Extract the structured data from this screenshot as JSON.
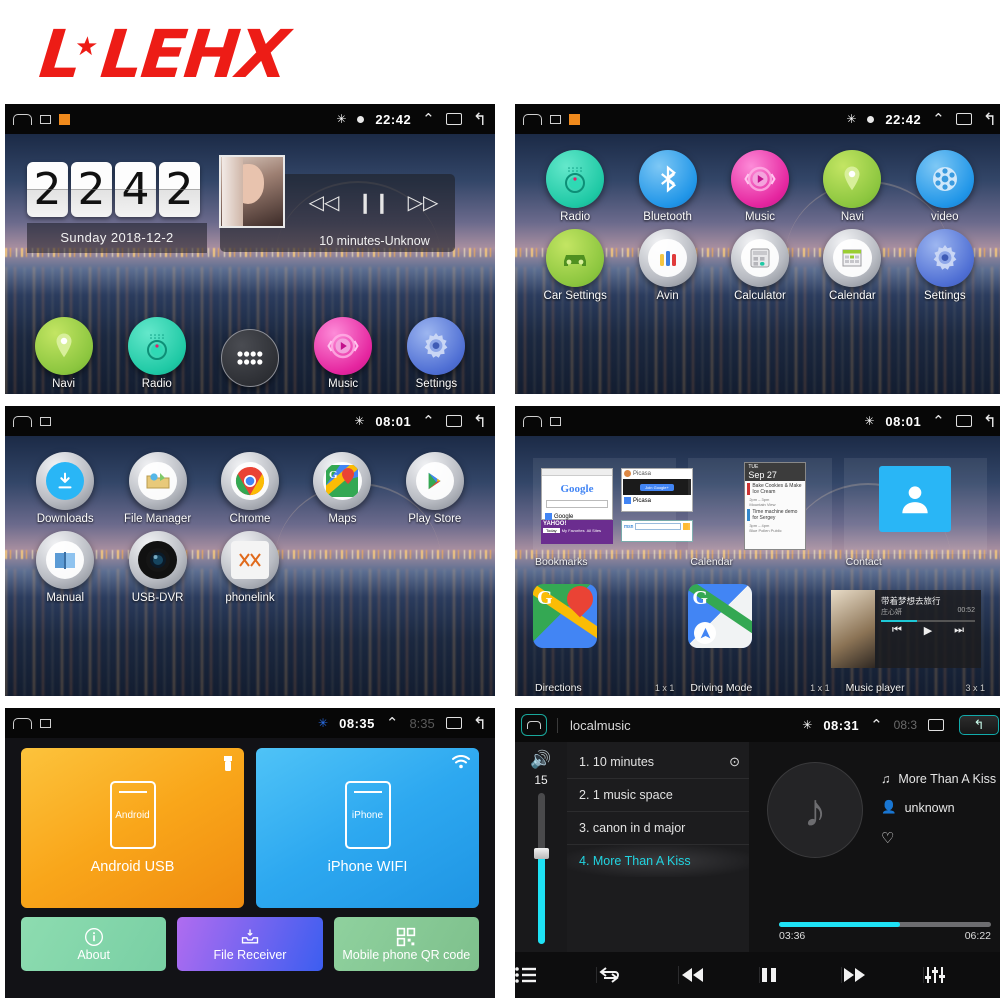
{
  "brand": {
    "name": "LEHX",
    "color": "#ED1C16",
    "star_icon": "star-icon"
  },
  "panels": {
    "home": {
      "statusbar": {
        "time": "22:42",
        "icons": [
          "home-icon",
          "screenshot-icon",
          "app-icon",
          "bluetooth-icon",
          "dot-icon",
          "chevron-up-icon",
          "recents-icon",
          "back-icon"
        ]
      },
      "clock": {
        "digits": [
          "2",
          "2",
          "4",
          "2"
        ],
        "date": "Sunday  2018-12-2"
      },
      "music_widget": {
        "title": "10 minutes-Unknow",
        "prev": "prev-icon",
        "play": "pause-icon",
        "next": "next-icon"
      },
      "dock": [
        {
          "label": "Navi",
          "icon": "location-pin-icon",
          "color": "#8cc63f"
        },
        {
          "label": "Radio",
          "icon": "radio-knob-icon",
          "color": "#1fc9a5"
        },
        {
          "label": "",
          "icon": "app-drawer-icon",
          "color": "#2a2c31"
        },
        {
          "label": "Music",
          "icon": "play-circle-icon",
          "color": "#e5259f"
        },
        {
          "label": "Settings",
          "icon": "gear-icon",
          "color": "#4f6fd4"
        }
      ]
    },
    "apps": {
      "statusbar": {
        "time": "22:42"
      },
      "items": [
        {
          "label": "Radio",
          "icon": "radio-knob-icon",
          "color": "#1fc9a5"
        },
        {
          "label": "Bluetooth",
          "icon": "bluetooth-icon",
          "color": "#2196e8"
        },
        {
          "label": "Music",
          "icon": "play-circle-icon",
          "color": "#e5259f"
        },
        {
          "label": "Navi",
          "icon": "location-pin-icon",
          "color": "#8cc63f"
        },
        {
          "label": "video",
          "icon": "film-reel-icon",
          "color": "#2196e8"
        },
        {
          "label": "Car Settings",
          "icon": "car-icon",
          "color": "#8cc63f"
        },
        {
          "label": "Avin",
          "icon": "avin-plugs-icon",
          "color": "#b9bcc3"
        },
        {
          "label": "Calculator",
          "icon": "calculator-icon",
          "color": "#b9bcc3"
        },
        {
          "label": "Calendar",
          "icon": "calendar-icon",
          "color": "#b9bcc3"
        },
        {
          "label": "Settings",
          "icon": "gear-icon",
          "color": "#4f6fd4"
        }
      ]
    },
    "apps2": {
      "statusbar": {
        "time": "08:01"
      },
      "items": [
        {
          "label": "Downloads",
          "icon": "download-icon"
        },
        {
          "label": "File Manager",
          "icon": "file-manager-icon"
        },
        {
          "label": "Chrome",
          "icon": "chrome-icon"
        },
        {
          "label": "Maps",
          "icon": "maps-icon"
        },
        {
          "label": "Play Store",
          "icon": "play-store-icon"
        },
        {
          "label": "Manual",
          "icon": "book-icon"
        },
        {
          "label": "USB-DVR",
          "icon": "camera-icon"
        },
        {
          "label": "phonelink",
          "icon": "phonelink-icon"
        }
      ]
    },
    "widgets": {
      "statusbar": {
        "time": "08:01"
      },
      "row1": [
        {
          "label": "Bookmarks",
          "size": "",
          "thumbs": [
            "Google",
            "Picasa",
            "YAHOO!",
            "msn"
          ]
        },
        {
          "label": "Calendar",
          "size": "",
          "cal_day": "TUE",
          "cal_date": "Sep 27",
          "events": [
            "Bake Cookies & Make Ice Cream",
            "Time machine demo for Sergey"
          ]
        },
        {
          "label": "Contact",
          "size": "",
          "icon": "contact-icon"
        }
      ],
      "row2": [
        {
          "label": "Directions",
          "size": "1 x 1",
          "icon": "maps-icon"
        },
        {
          "label": "Driving Mode",
          "size": "1 x 1",
          "icon": "driving-mode-icon"
        },
        {
          "label": "Music player",
          "size": "3 x 1",
          "track": "带着梦想去旅行",
          "artist": "庄心妍",
          "time": "00:52"
        }
      ]
    },
    "phonelink": {
      "statusbar": {
        "time": "08:35",
        "ghost_time": "8:35"
      },
      "tiles": [
        {
          "label": "Android USB",
          "phone_text": "Android",
          "corner_icon": "usb-icon",
          "color": "#f9a61a"
        },
        {
          "label": "iPhone WIFI",
          "phone_text": "iPhone",
          "corner_icon": "wifi-icon",
          "color": "#2da8f0"
        }
      ],
      "buttons": [
        {
          "label": "About",
          "icon": "info-icon",
          "color": "#79cfa4"
        },
        {
          "label": "File Receiver",
          "icon": "inbox-download-icon",
          "color": "#3c5ef0"
        },
        {
          "label": "Mobile phone QR code",
          "icon": "qr-code-icon",
          "color": "#7ec08c"
        }
      ]
    },
    "player": {
      "statusbar": {
        "time": "08:31",
        "ghost_time": "08:3"
      },
      "app_title": "localmusic",
      "volume": {
        "value": "15",
        "icon": "speaker-icon",
        "percent": 58
      },
      "playlist": [
        {
          "label": "1. 10 minutes",
          "active": false,
          "trailing_icon": "play-history-icon"
        },
        {
          "label": "2. 1 music space",
          "active": false,
          "trailing_icon": ""
        },
        {
          "label": "3. canon in d major",
          "active": false,
          "trailing_icon": ""
        },
        {
          "label": "4. More Than A Kiss",
          "active": true,
          "trailing_icon": ""
        }
      ],
      "now_playing": {
        "art_icon": "music-note-icon",
        "title": "More Than A Kiss",
        "artist": "unknown",
        "favorite_icon": "heart-icon",
        "elapsed": "03:36",
        "total": "06:22",
        "percent": 57
      },
      "controls": [
        {
          "icon": "playlist-icon",
          "name": "playlist-button"
        },
        {
          "icon": "repeat-icon",
          "name": "repeat-button"
        },
        {
          "icon": "previous-icon",
          "name": "previous-button"
        },
        {
          "icon": "pause-icon",
          "name": "pause-button"
        },
        {
          "icon": "next-icon",
          "name": "next-button"
        },
        {
          "icon": "equalizer-icon",
          "name": "equalizer-button"
        }
      ]
    }
  }
}
